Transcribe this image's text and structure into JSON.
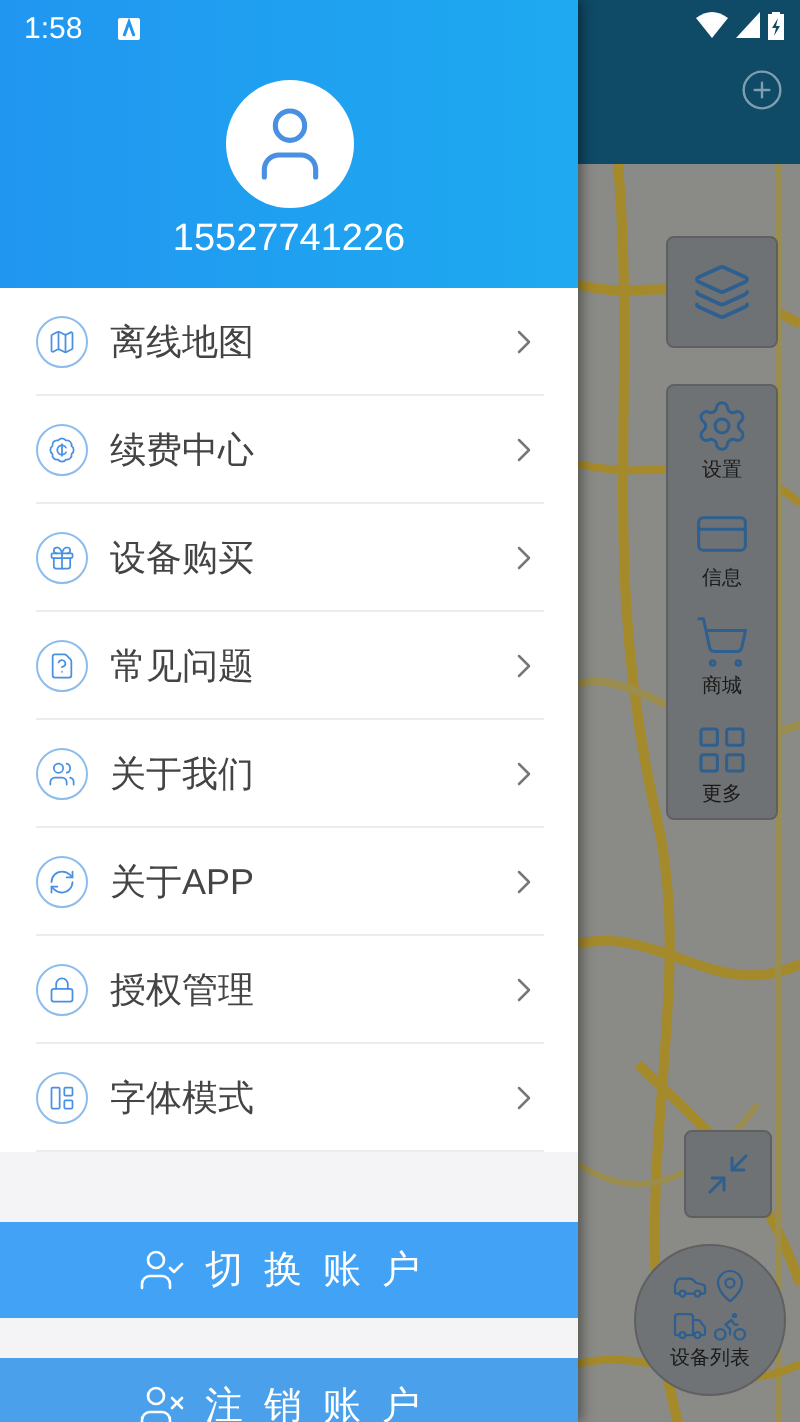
{
  "status_bar": {
    "time": "1:58"
  },
  "profile": {
    "phone": "15527741226"
  },
  "menu": [
    {
      "label": "离线地图"
    },
    {
      "label": "续费中心"
    },
    {
      "label": "设备购买"
    },
    {
      "label": "常见问题"
    },
    {
      "label": "关于我们"
    },
    {
      "label": "关于APP"
    },
    {
      "label": "授权管理"
    },
    {
      "label": "字体模式"
    }
  ],
  "buttons": [
    {
      "label": "切换账户",
      "kind": "switch"
    },
    {
      "label": "注销账户",
      "kind": "logout"
    }
  ],
  "map_tools": [
    {
      "label": "设置"
    },
    {
      "label": "信息"
    },
    {
      "label": "商城"
    },
    {
      "label": "更多"
    }
  ],
  "device_list": {
    "label": "设备列表"
  }
}
